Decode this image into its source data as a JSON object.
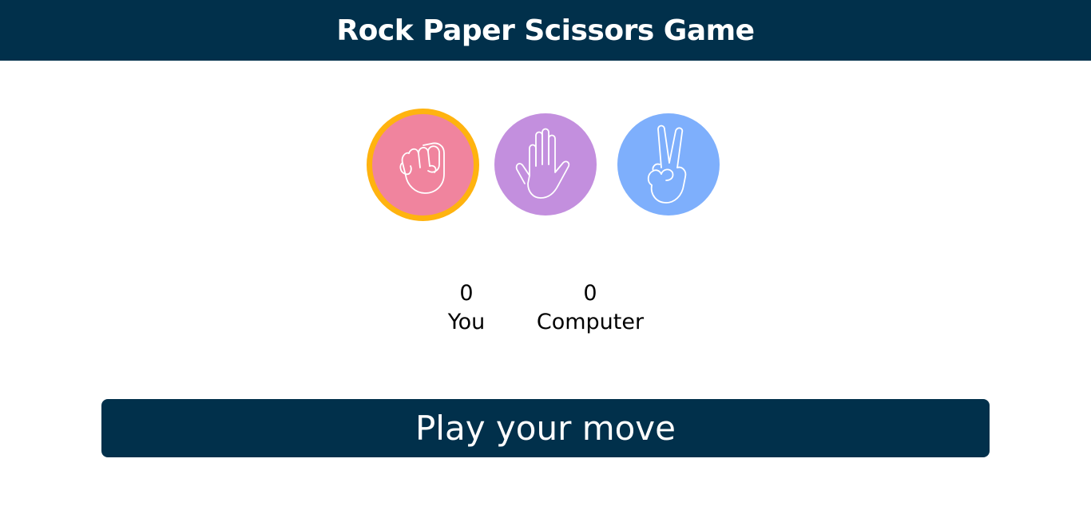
{
  "header": {
    "title": "Rock Paper Scissors Game"
  },
  "choices": [
    {
      "name": "rock",
      "icon": "rock-fist-icon",
      "color": "#f0849e",
      "selected": true
    },
    {
      "name": "paper",
      "icon": "paper-hand-icon",
      "color": "#c38fde",
      "selected": false
    },
    {
      "name": "scissors",
      "icon": "scissors-hand-icon",
      "color": "#7eaffc",
      "selected": false
    }
  ],
  "scores": {
    "you": {
      "value": "0",
      "label": "You"
    },
    "computer": {
      "value": "0",
      "label": "Computer"
    }
  },
  "play_button": {
    "label": "Play your move"
  },
  "colors": {
    "header_bg": "#01304b",
    "selected_ring": "#ffb30f",
    "button_bg": "#01304b"
  }
}
